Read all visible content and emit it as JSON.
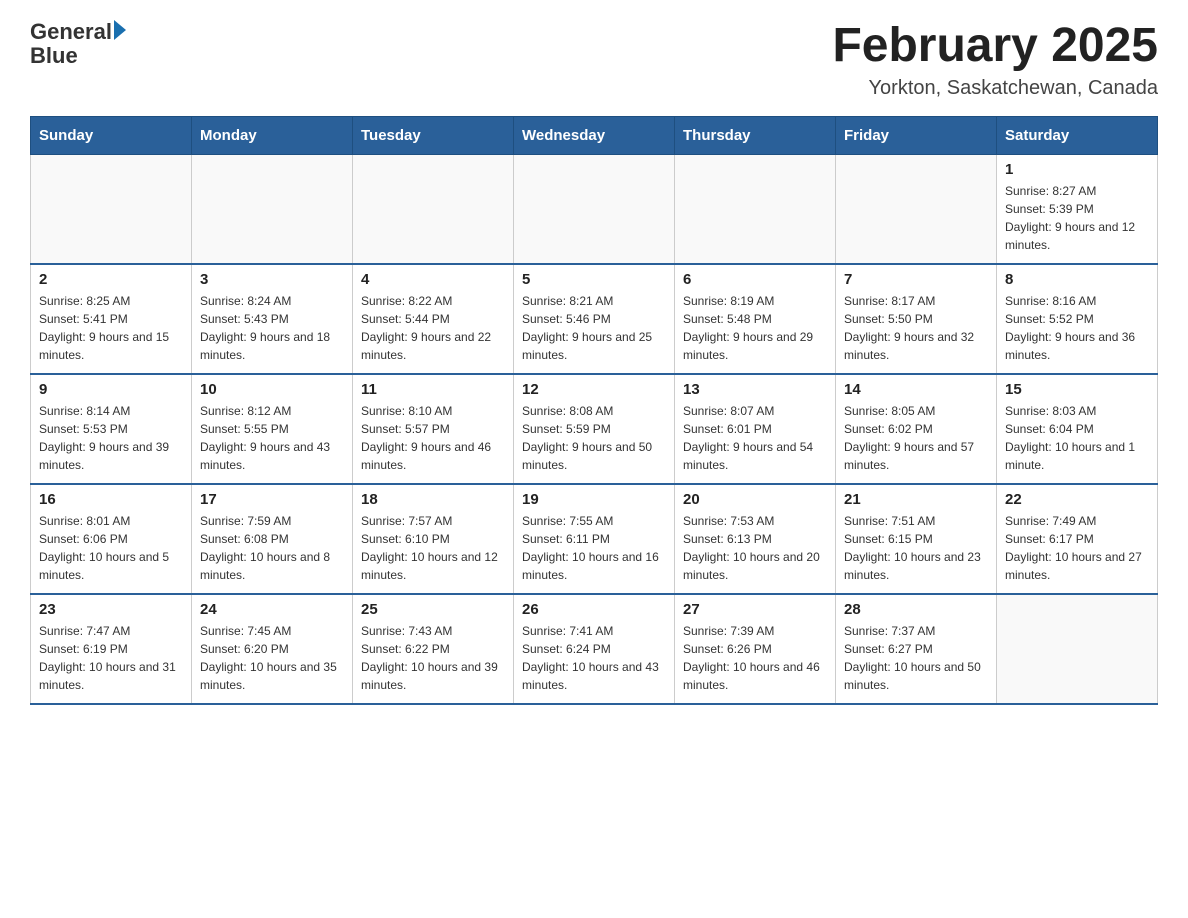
{
  "header": {
    "logo_general": "General",
    "logo_blue": "Blue",
    "month_title": "February 2025",
    "location": "Yorkton, Saskatchewan, Canada"
  },
  "days_of_week": [
    "Sunday",
    "Monday",
    "Tuesday",
    "Wednesday",
    "Thursday",
    "Friday",
    "Saturday"
  ],
  "weeks": [
    [
      {
        "day": "",
        "info": ""
      },
      {
        "day": "",
        "info": ""
      },
      {
        "day": "",
        "info": ""
      },
      {
        "day": "",
        "info": ""
      },
      {
        "day": "",
        "info": ""
      },
      {
        "day": "",
        "info": ""
      },
      {
        "day": "1",
        "info": "Sunrise: 8:27 AM\nSunset: 5:39 PM\nDaylight: 9 hours and 12 minutes."
      }
    ],
    [
      {
        "day": "2",
        "info": "Sunrise: 8:25 AM\nSunset: 5:41 PM\nDaylight: 9 hours and 15 minutes."
      },
      {
        "day": "3",
        "info": "Sunrise: 8:24 AM\nSunset: 5:43 PM\nDaylight: 9 hours and 18 minutes."
      },
      {
        "day": "4",
        "info": "Sunrise: 8:22 AM\nSunset: 5:44 PM\nDaylight: 9 hours and 22 minutes."
      },
      {
        "day": "5",
        "info": "Sunrise: 8:21 AM\nSunset: 5:46 PM\nDaylight: 9 hours and 25 minutes."
      },
      {
        "day": "6",
        "info": "Sunrise: 8:19 AM\nSunset: 5:48 PM\nDaylight: 9 hours and 29 minutes."
      },
      {
        "day": "7",
        "info": "Sunrise: 8:17 AM\nSunset: 5:50 PM\nDaylight: 9 hours and 32 minutes."
      },
      {
        "day": "8",
        "info": "Sunrise: 8:16 AM\nSunset: 5:52 PM\nDaylight: 9 hours and 36 minutes."
      }
    ],
    [
      {
        "day": "9",
        "info": "Sunrise: 8:14 AM\nSunset: 5:53 PM\nDaylight: 9 hours and 39 minutes."
      },
      {
        "day": "10",
        "info": "Sunrise: 8:12 AM\nSunset: 5:55 PM\nDaylight: 9 hours and 43 minutes."
      },
      {
        "day": "11",
        "info": "Sunrise: 8:10 AM\nSunset: 5:57 PM\nDaylight: 9 hours and 46 minutes."
      },
      {
        "day": "12",
        "info": "Sunrise: 8:08 AM\nSunset: 5:59 PM\nDaylight: 9 hours and 50 minutes."
      },
      {
        "day": "13",
        "info": "Sunrise: 8:07 AM\nSunset: 6:01 PM\nDaylight: 9 hours and 54 minutes."
      },
      {
        "day": "14",
        "info": "Sunrise: 8:05 AM\nSunset: 6:02 PM\nDaylight: 9 hours and 57 minutes."
      },
      {
        "day": "15",
        "info": "Sunrise: 8:03 AM\nSunset: 6:04 PM\nDaylight: 10 hours and 1 minute."
      }
    ],
    [
      {
        "day": "16",
        "info": "Sunrise: 8:01 AM\nSunset: 6:06 PM\nDaylight: 10 hours and 5 minutes."
      },
      {
        "day": "17",
        "info": "Sunrise: 7:59 AM\nSunset: 6:08 PM\nDaylight: 10 hours and 8 minutes."
      },
      {
        "day": "18",
        "info": "Sunrise: 7:57 AM\nSunset: 6:10 PM\nDaylight: 10 hours and 12 minutes."
      },
      {
        "day": "19",
        "info": "Sunrise: 7:55 AM\nSunset: 6:11 PM\nDaylight: 10 hours and 16 minutes."
      },
      {
        "day": "20",
        "info": "Sunrise: 7:53 AM\nSunset: 6:13 PM\nDaylight: 10 hours and 20 minutes."
      },
      {
        "day": "21",
        "info": "Sunrise: 7:51 AM\nSunset: 6:15 PM\nDaylight: 10 hours and 23 minutes."
      },
      {
        "day": "22",
        "info": "Sunrise: 7:49 AM\nSunset: 6:17 PM\nDaylight: 10 hours and 27 minutes."
      }
    ],
    [
      {
        "day": "23",
        "info": "Sunrise: 7:47 AM\nSunset: 6:19 PM\nDaylight: 10 hours and 31 minutes."
      },
      {
        "day": "24",
        "info": "Sunrise: 7:45 AM\nSunset: 6:20 PM\nDaylight: 10 hours and 35 minutes."
      },
      {
        "day": "25",
        "info": "Sunrise: 7:43 AM\nSunset: 6:22 PM\nDaylight: 10 hours and 39 minutes."
      },
      {
        "day": "26",
        "info": "Sunrise: 7:41 AM\nSunset: 6:24 PM\nDaylight: 10 hours and 43 minutes."
      },
      {
        "day": "27",
        "info": "Sunrise: 7:39 AM\nSunset: 6:26 PM\nDaylight: 10 hours and 46 minutes."
      },
      {
        "day": "28",
        "info": "Sunrise: 7:37 AM\nSunset: 6:27 PM\nDaylight: 10 hours and 50 minutes."
      },
      {
        "day": "",
        "info": ""
      }
    ]
  ]
}
